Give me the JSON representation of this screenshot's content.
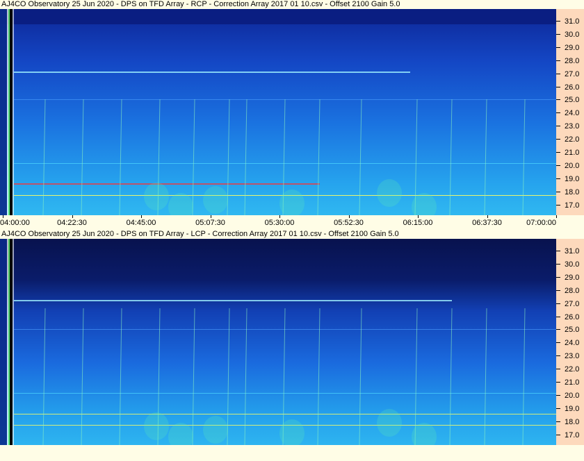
{
  "panels": [
    {
      "title": "AJ4CO Observatory 25 Jun 2020  -  DPS on TFD Array  -  RCP  -  Correction Array 2017 01 10.csv  -  Offset 2100  Gain 5.0",
      "polarization": "RCP"
    },
    {
      "title": "AJ4CO Observatory 25 Jun 2020  -  DPS on TFD Array  -  LCP  -  Correction Array 2017 01 10.csv  -  Offset 2100  Gain 5.0",
      "polarization": "LCP"
    }
  ],
  "y_ticks": [
    "31.0",
    "30.0",
    "29.0",
    "28.0",
    "27.0",
    "26.0",
    "25.0",
    "24.0",
    "23.0",
    "22.0",
    "21.0",
    "20.0",
    "19.0",
    "18.0",
    "17.0"
  ],
  "x_ticks": [
    "04:00:00",
    "04:22:30",
    "04:45:00",
    "05:07:30",
    "05:30:00",
    "05:52:30",
    "06:15:00",
    "06:37:30",
    "07:00:00"
  ],
  "colors": {
    "background": "#fffde6",
    "axis_panel": "#fdd9bc",
    "spectrogram_dark": "#0a1a7a",
    "spectrogram_mid": "#1550d8",
    "spectrogram_light": "#2aa8f0",
    "band_yellow": "#ffff60",
    "band_red": "#ff3030"
  }
}
